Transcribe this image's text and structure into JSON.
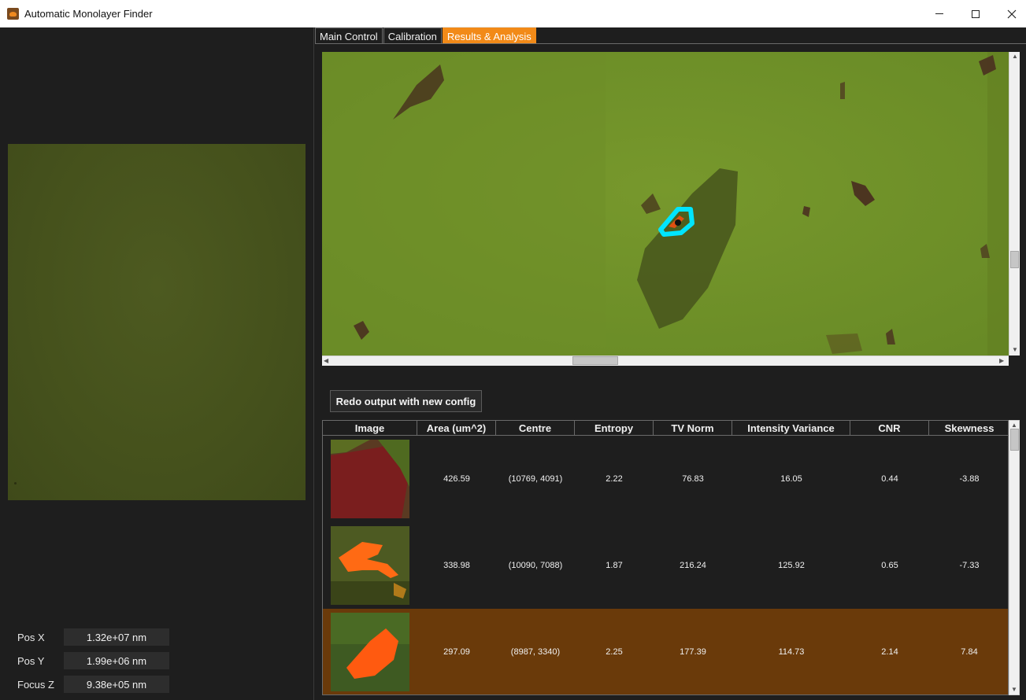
{
  "window": {
    "title": "Automatic Monolayer Finder",
    "minimize_icon": "minimize-icon",
    "maximize_icon": "maximize-icon",
    "close_icon": "close-icon"
  },
  "tabs": [
    {
      "label": "Main Control",
      "active": false
    },
    {
      "label": "Calibration",
      "active": false
    },
    {
      "label": "Results & Analysis",
      "active": true
    }
  ],
  "position": {
    "x_label": "Pos X",
    "x_value": "1.32e+07 nm",
    "y_label": "Pos Y",
    "y_value": "1.99e+06 nm",
    "z_label": "Focus Z",
    "z_value": "9.38e+05 nm"
  },
  "actions": {
    "redo_label": "Redo output with new config"
  },
  "table": {
    "columns": [
      "Image",
      "Area (um^2)",
      "Centre",
      "Entropy",
      "TV Norm",
      "Intensity Variance",
      "CNR",
      "Skewness"
    ],
    "rows": [
      {
        "area": "426.59",
        "centre": "(10769, 4091)",
        "entropy": "2.22",
        "tv_norm": "76.83",
        "intensity_variance": "16.05",
        "cnr": "0.44",
        "skewness": "-3.88",
        "selected": false
      },
      {
        "area": "338.98",
        "centre": "(10090, 7088)",
        "entropy": "1.87",
        "tv_norm": "216.24",
        "intensity_variance": "125.92",
        "cnr": "0.65",
        "skewness": "-7.33",
        "selected": false
      },
      {
        "area": "297.09",
        "centre": "(8987, 3340)",
        "entropy": "2.25",
        "tv_norm": "177.39",
        "intensity_variance": "114.73",
        "cnr": "2.14",
        "skewness": "7.84",
        "selected": true
      }
    ]
  },
  "colors": {
    "accent": "#f28a18",
    "selected_row": "#6a3a0a",
    "background": "#1e1e1e",
    "highlight_outline": "#00e5ff"
  }
}
